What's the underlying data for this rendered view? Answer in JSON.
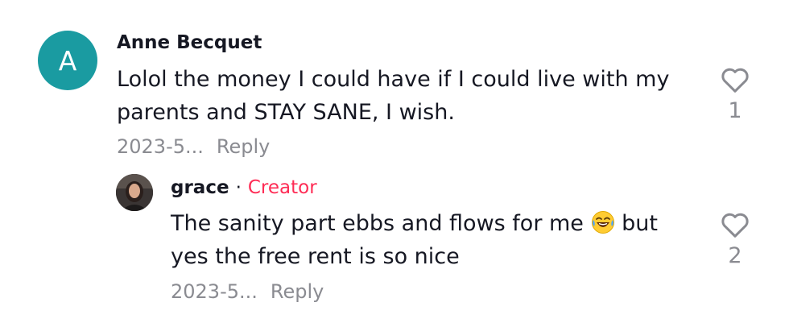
{
  "comment": {
    "avatar_letter": "A",
    "avatar_color": "#1a9ba1",
    "username": "Anne Becquet",
    "text": "Lolol the money I could have if I could live with my parents and STAY SANE, I wish.",
    "date": "2023-5...",
    "reply_label": "Reply",
    "like_icon": "heart-outline-icon",
    "like_count": "1"
  },
  "reply": {
    "username": "grace",
    "separator": "·",
    "badge": "Creator",
    "badge_color": "#fe2c55",
    "text_before_emoji": "The sanity part ebbs and flows for me",
    "emoji_icon": "face-with-tears-of-joy-icon",
    "text_after_emoji": "but yes the free rent is so nice",
    "date": "2023-5...",
    "reply_label": "Reply",
    "like_icon": "heart-outline-icon",
    "like_count": "2"
  }
}
